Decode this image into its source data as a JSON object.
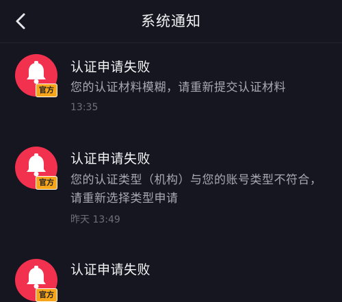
{
  "nav": {
    "title": "系统通知"
  },
  "icons": {
    "back": "chevron-left-icon",
    "bell": "bell-icon"
  },
  "colors": {
    "background": "#161620",
    "avatar": "#f2314f",
    "badge": "#f7a51a"
  },
  "notifications": [
    {
      "title": "认证申请失败",
      "body": "您的认证材料模糊，请重新提交认证材料",
      "time": "13:35",
      "badge": "官方"
    },
    {
      "title": "认证申请失败",
      "body": "您的认证类型（机构）与您的账号类型不符合，请重新选择类型申请",
      "time": "昨天 13:49",
      "badge": "官方"
    },
    {
      "title": "认证申请失败",
      "badge": "官方"
    }
  ]
}
